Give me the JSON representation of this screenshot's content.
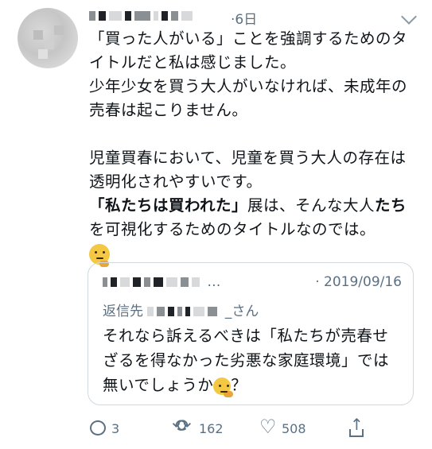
{
  "tweet": {
    "time": "·6日",
    "body_lines": [
      "「買った人がいる」ことを強調するためのタ",
      "イトルだと私は感じました。",
      "少年少女を買う大人がいなければ、未成年の",
      "売春は起こりません。",
      "",
      "児童買春において、児童を買う大人の存在は",
      "透明化されやすいです。"
    ],
    "bold_1": "「私たちは買われた」",
    "mid_1": "展は、そんな大人",
    "bold_2": "たち",
    "end_line": "を可視化するためのタイトルなのでは。",
    "emoji": "thinking-face"
  },
  "quote": {
    "ellipsis": "…",
    "date": "· 2019/09/16",
    "reply_prefix": "返信先",
    "reply_suffix": "_さん",
    "text_lines": [
      "それなら訴えるべきは「私たちが売春せ",
      "ざるを得なかった劣悪な家庭環境」では",
      "無いでしょうか"
    ],
    "text_tail": "？",
    "emoji": "thinking-face"
  },
  "actions": {
    "reply_count": "3",
    "retweet_count": "162",
    "like_count": "508"
  },
  "colors": {
    "secondary_text": "#5b7083",
    "border": "#cfd9de"
  }
}
